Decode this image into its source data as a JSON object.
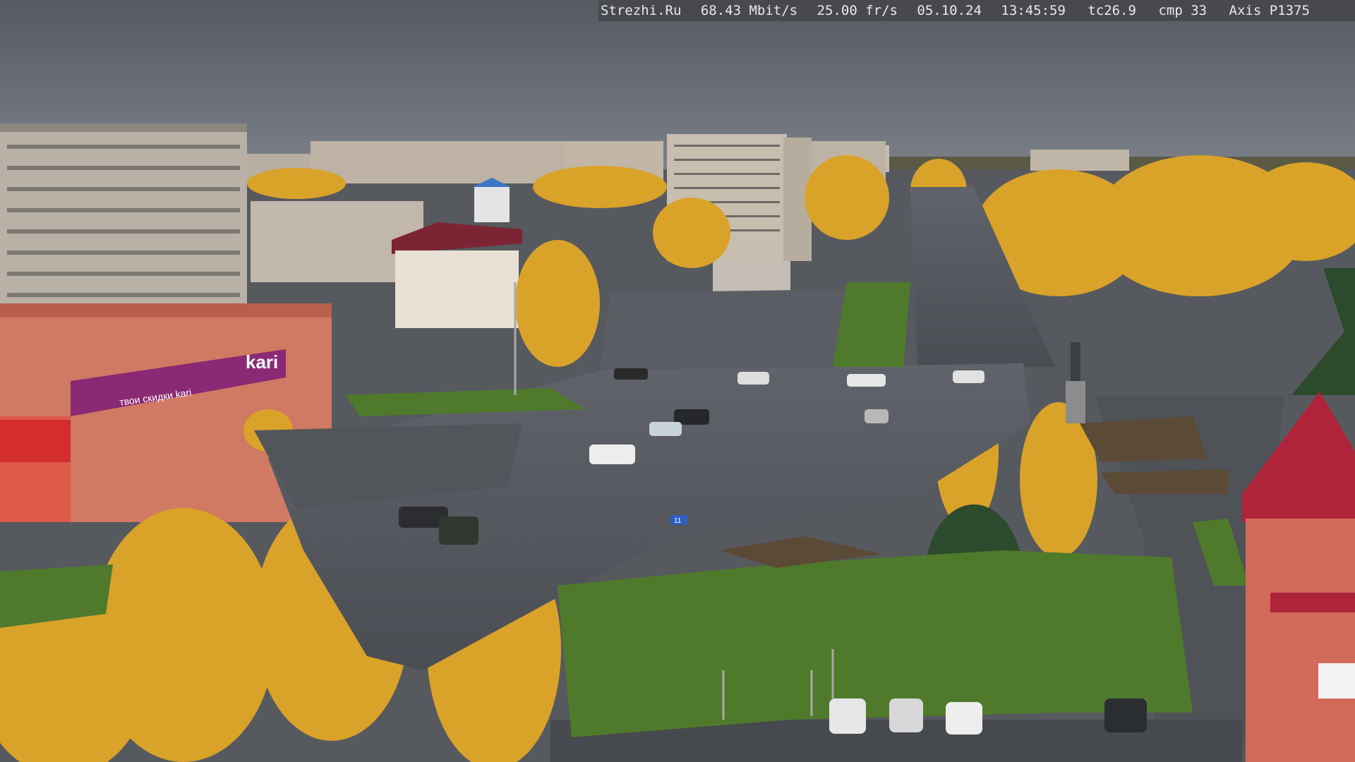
{
  "osd": {
    "site": "Strezhi.Ru",
    "bitrate": "68.43 Mbit/s",
    "framerate": "25.00 fr/s",
    "date": "05.10.24",
    "time": "13:45:59",
    "tc": "tc26.9",
    "cmp": "cmp 33",
    "camera": "Axis P1375"
  },
  "signs": {
    "store_logo": "kari",
    "store_banner": "твои скидки kari",
    "street_sign": "11"
  },
  "palette": {
    "sky": "#646870",
    "asphalt": "#4e5257",
    "birch_yellow": "#d9a229",
    "grass": "#4f7a2c",
    "store_purple": "#8a2a74",
    "roof_red": "#b0243a"
  }
}
